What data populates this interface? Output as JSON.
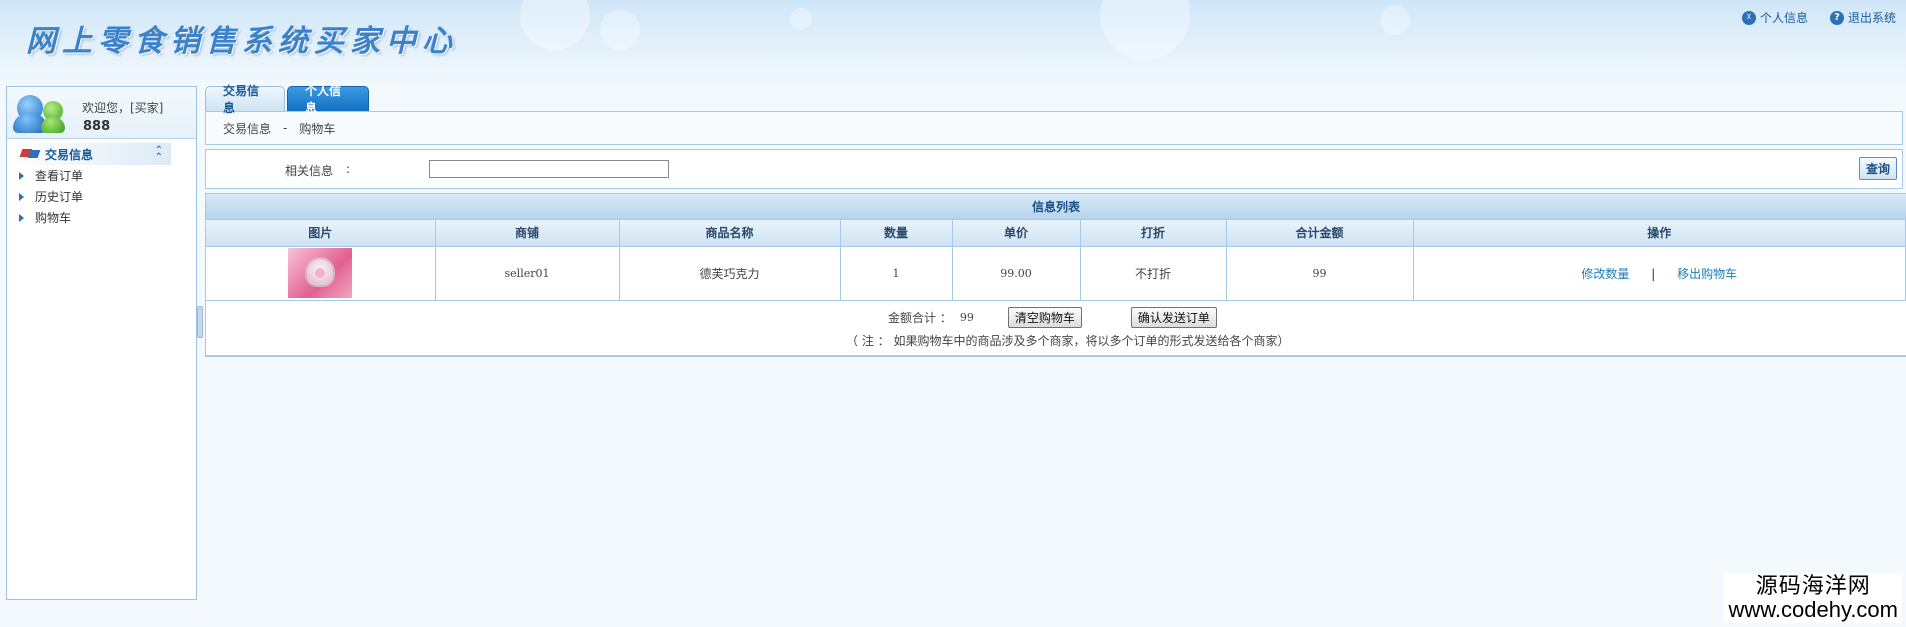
{
  "header": {
    "app_title": "网上零食销售系统买家中心",
    "links": [
      {
        "label": "个人信息",
        "icon": "person-info-icon",
        "glyph": "☓"
      },
      {
        "label": "退出系统",
        "icon": "help-exit-icon",
        "glyph": "?"
      }
    ]
  },
  "sidebar": {
    "welcome": "欢迎您，[买家]",
    "username": "888",
    "group_label": "交易信息",
    "group_toggle": "⌃",
    "items": [
      "查看订单",
      "历史订单",
      "购物车"
    ]
  },
  "tabs": [
    "交易信息",
    "个人信息"
  ],
  "breadcrumb": {
    "section": "交易信息",
    "separator": "-",
    "page": "购物车"
  },
  "search": {
    "label": "相关信息",
    "colon": ":",
    "value": "",
    "button": "查询"
  },
  "list": {
    "title": "信息列表",
    "columns": [
      "图片",
      "商铺",
      "商品名称",
      "数量",
      "单价",
      "打折",
      "合计金额",
      "操作"
    ],
    "rows": [
      {
        "shop": "seller01",
        "product": "德芙巧克力",
        "quantity": "1",
        "unit_price": "99.00",
        "discount": "不打折",
        "total": "99",
        "actions": {
          "edit": "修改数量",
          "sep": "|",
          "remove": "移出购物车"
        }
      }
    ]
  },
  "summary": {
    "total_label": "金额合计 ：",
    "total_value": "99",
    "clear_button": "清空购物车",
    "confirm_button": "确认发送订单",
    "note": "（ 注 ： 如果购物车中的商品涉及多个商家，将以多个订单的形式发送给各个商家）"
  },
  "watermark": {
    "line1": "源码海洋网",
    "line2": "www.codehy.com"
  }
}
